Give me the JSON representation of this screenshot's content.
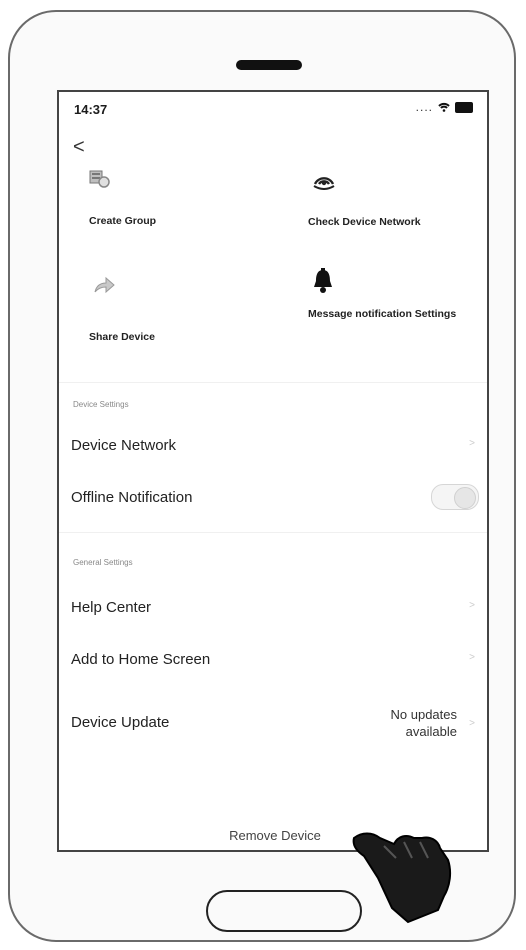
{
  "status_bar": {
    "time": "14:37",
    "dots": "...."
  },
  "nav": {
    "back_glyph": "<"
  },
  "actions": [
    {
      "label": "Create Group",
      "icon": "group-icon"
    },
    {
      "label": "Check Device Network",
      "icon": "network-icon"
    },
    {
      "label": "Share Device",
      "icon": "share-icon"
    },
    {
      "label": "Message notification Settings",
      "icon": "bell-icon"
    }
  ],
  "sections": {
    "device_settings": {
      "caption": "Device Settings",
      "items": {
        "network": "Device Network",
        "offline": "Offline Notification"
      }
    },
    "general_settings": {
      "caption": "General Settings",
      "items": {
        "help": "Help Center",
        "home_screen": "Add to Home Screen",
        "update": "Device Update",
        "update_status": "No updates available"
      }
    }
  },
  "footer": {
    "remove": "Remove Device"
  },
  "colors": {
    "text": "#1c1c1c",
    "muted": "#888888",
    "frame": "#6a6a6a"
  }
}
